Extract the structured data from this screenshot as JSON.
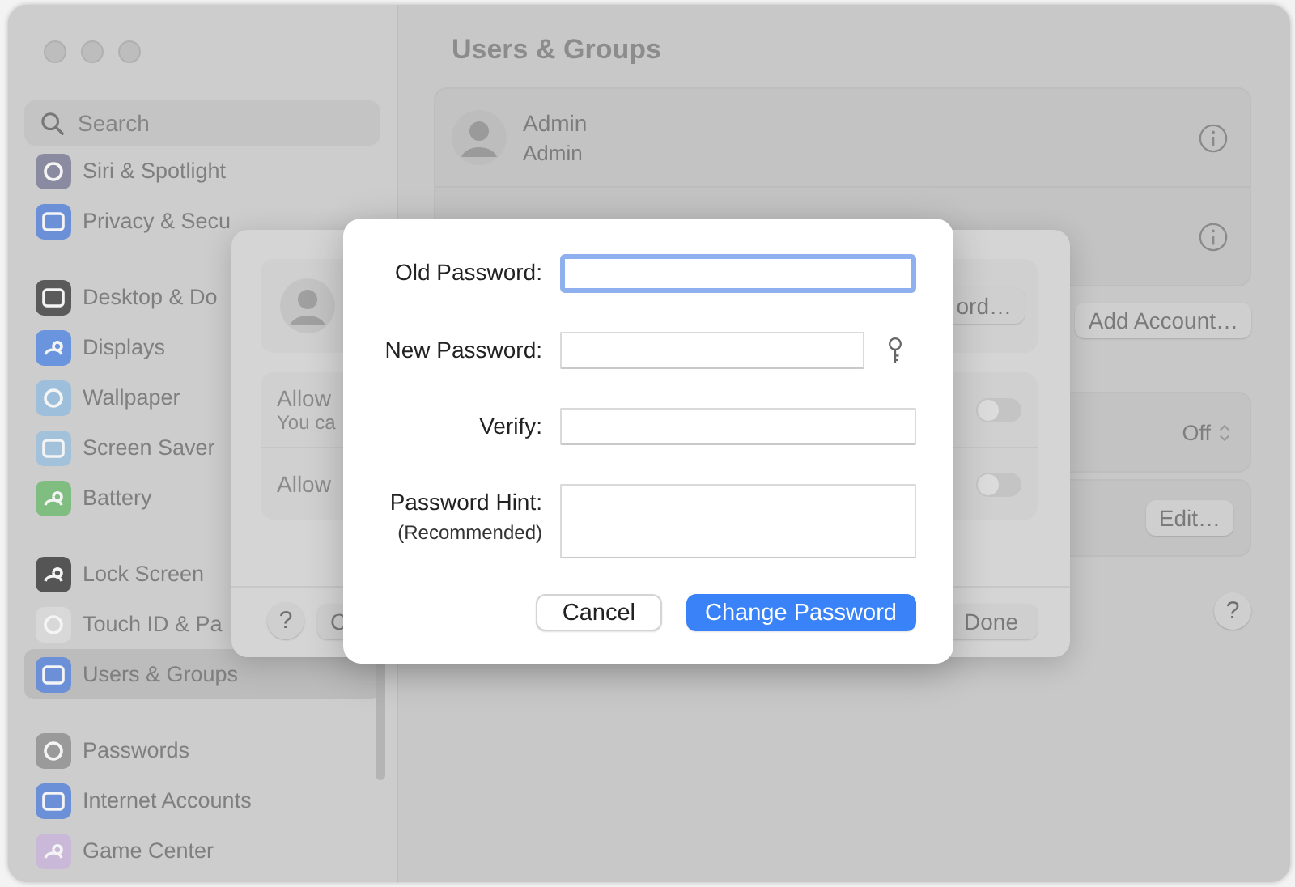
{
  "sidebar": {
    "search": {
      "placeholder": "Search"
    },
    "groups": [
      {
        "items": [
          {
            "label": "Siri & Spotlight",
            "color": "#8a8aa0",
            "selected": false
          },
          {
            "label": "Privacy & Secu",
            "color": "#6b90d8",
            "selected": false
          }
        ]
      },
      {
        "items": [
          {
            "label": "Desktop & Do",
            "color": "#5a5a5a",
            "selected": false
          },
          {
            "label": "Displays",
            "color": "#6a95de",
            "selected": false
          },
          {
            "label": "Wallpaper",
            "color": "#9dbfdc",
            "selected": false
          },
          {
            "label": "Screen Saver",
            "color": "#a2c2dc",
            "selected": false
          },
          {
            "label": "Battery",
            "color": "#80bd80",
            "selected": false
          }
        ]
      },
      {
        "items": [
          {
            "label": "Lock Screen",
            "color": "#555555",
            "selected": false
          },
          {
            "label": "Touch ID & Pa",
            "color": "#d8d8d8",
            "selected": false
          },
          {
            "label": "Users & Groups",
            "color": "#6b90d8",
            "selected": true
          }
        ]
      },
      {
        "items": [
          {
            "label": "Passwords",
            "color": "#9a9a9a",
            "selected": false
          },
          {
            "label": "Internet Accounts",
            "color": "#6b90d8",
            "selected": false
          },
          {
            "label": "Game Center",
            "color": "#c9b8d8",
            "selected": false
          }
        ]
      }
    ]
  },
  "main": {
    "title": "Users & Groups",
    "user": {
      "name": "Admin",
      "role": "Admin"
    },
    "add_button": "Add Account…",
    "popup_value": "Off",
    "edit_button": "Edit…",
    "help": "?"
  },
  "sheet": {
    "top_button": "ord…",
    "rows": [
      {
        "title": "Allow",
        "subtitle": "You ca",
        "on": false
      },
      {
        "title": "Allow",
        "on": false
      }
    ],
    "help": "?",
    "left_button": "C",
    "done_button": "Done"
  },
  "dialog": {
    "fields": [
      {
        "label": "Old Password:",
        "kind": "single",
        "focused": true
      },
      {
        "label": "New Password:",
        "kind": "single",
        "focused": false,
        "password_assistant": true
      },
      {
        "label": "Verify:",
        "kind": "single",
        "focused": false
      },
      {
        "label": "Password Hint:",
        "sublabel": "(Recommended)",
        "kind": "multiline",
        "focused": false
      }
    ],
    "buttons": [
      {
        "label": "Cancel",
        "default": false
      },
      {
        "label": "Change Password",
        "default": true
      }
    ]
  }
}
